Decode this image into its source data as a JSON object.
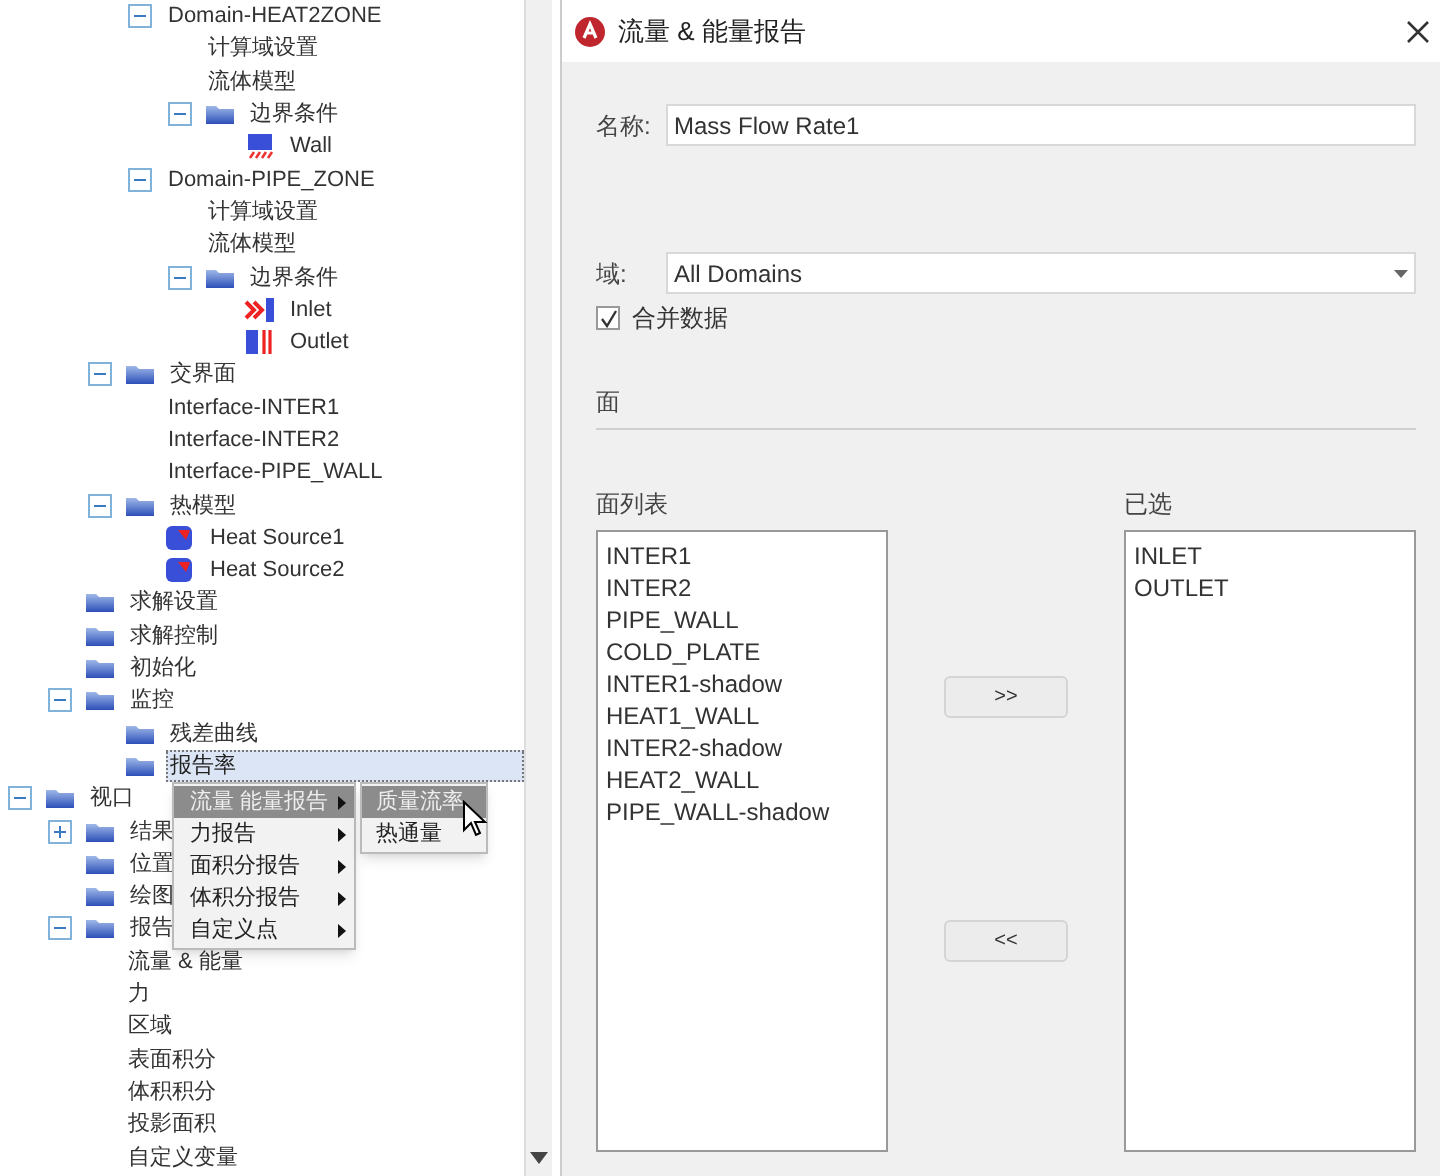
{
  "tree": {
    "items": [
      {
        "children": [
          {
            "children": [
              {
                "children": [
                  {
                    "label": "Domain-HEAT2ZONE",
                    "kind": "none",
                    "expanded": true,
                    "selected": false,
                    "children": [
                      {
                        "label": "计算域设置",
                        "kind": "none",
                        "selected": false
                      },
                      {
                        "label": "流体模型",
                        "kind": "none",
                        "selected": false
                      },
                      {
                        "label": "边界条件",
                        "kind": "folder",
                        "expanded": true,
                        "selected": false,
                        "children": [
                          {
                            "label": "Wall",
                            "kind": "wall",
                            "selected": false
                          }
                        ]
                      }
                    ]
                  },
                  {
                    "label": "Domain-PIPE_ZONE",
                    "kind": "none",
                    "expanded": true,
                    "selected": false,
                    "children": [
                      {
                        "label": "计算域设置",
                        "kind": "none",
                        "selected": false
                      },
                      {
                        "label": "流体模型",
                        "kind": "none",
                        "selected": false
                      },
                      {
                        "label": "边界条件",
                        "kind": "folder",
                        "expanded": true,
                        "selected": false,
                        "children": [
                          {
                            "label": "Inlet",
                            "kind": "inlet",
                            "selected": false
                          },
                          {
                            "label": "Outlet",
                            "kind": "outlet",
                            "selected": false
                          }
                        ]
                      }
                    ]
                  }
                ]
              },
              {
                "label": "交界面",
                "kind": "folder",
                "expanded": true,
                "selected": false,
                "children": [
                  {
                    "label": "Interface-INTER1",
                    "kind": "none",
                    "selected": false
                  },
                  {
                    "label": "Interface-INTER2",
                    "kind": "none",
                    "selected": false
                  },
                  {
                    "label": "Interface-PIPE_WALL",
                    "kind": "none",
                    "selected": false
                  }
                ]
              },
              {
                "label": "热模型",
                "kind": "folder",
                "expanded": true,
                "selected": false,
                "children": [
                  {
                    "label": "Heat Source1",
                    "kind": "heat_source",
                    "selected": false
                  },
                  {
                    "label": "Heat Source2",
                    "kind": "heat_source",
                    "selected": false
                  }
                ]
              }
            ]
          },
          {
            "label": "求解设置",
            "kind": "folder",
            "selected": false
          },
          {
            "label": "求解控制",
            "kind": "folder",
            "selected": false
          },
          {
            "label": "初始化",
            "kind": "folder",
            "selected": false
          },
          {
            "label": "监控",
            "kind": "folder",
            "expanded": true,
            "selected": false,
            "children": [
              {
                "label": "残差曲线",
                "kind": "folder",
                "selected": false
              },
              {
                "label": "报告率",
                "kind": "folder",
                "selected": true
              }
            ]
          }
        ]
      },
      {
        "label": "视口",
        "kind": "folder",
        "expanded": true,
        "selected": false,
        "children": [
          {
            "label": "结果",
            "kind": "folder",
            "expanded": false,
            "selected": false
          },
          {
            "label": "位置",
            "kind": "folder",
            "selected": false
          },
          {
            "label": "绘图",
            "kind": "folder",
            "selected": false
          },
          {
            "label": "报告",
            "kind": "folder",
            "expanded": true,
            "selected": false,
            "children": [
              {
                "label": "流量 & 能量",
                "kind": "none",
                "selected": false
              },
              {
                "label": "力",
                "kind": "none",
                "selected": false
              },
              {
                "label": "区域",
                "kind": "none",
                "selected": false
              },
              {
                "label": "表面积分",
                "kind": "none",
                "selected": false
              },
              {
                "label": "体积积分",
                "kind": "none",
                "selected": false
              },
              {
                "label": "投影面积",
                "kind": "none",
                "selected": false
              },
              {
                "label": "自定义变量",
                "kind": "none",
                "selected": false
              }
            ]
          }
        ]
      }
    ]
  },
  "context_menu": {
    "items": [
      {
        "label": "流量 能量报告",
        "selected": true
      },
      {
        "label": "力报告",
        "selected": false
      },
      {
        "label": "面积分报告",
        "selected": false
      },
      {
        "label": "体积分报告",
        "selected": false
      },
      {
        "label": "自定义点",
        "selected": false
      }
    ],
    "submenu": [
      {
        "label": "质量流率",
        "selected": true
      },
      {
        "label": "热通量",
        "selected": false
      }
    ]
  },
  "dialog": {
    "title": "流量 & 能量报告",
    "name_label": "名称:",
    "name_value": "Mass Flow Rate1",
    "domain_label": "域:",
    "domain_value": "All Domains",
    "merge_label": "合并数据",
    "merge_checked": true,
    "faces_section": "面",
    "face_list_label": "面列表",
    "face_list": [
      "INTER1",
      "INTER2",
      "PIPE_WALL",
      "COLD_PLATE",
      "INTER1-shadow",
      "HEAT1_WALL",
      "INTER2-shadow",
      "HEAT2_WALL",
      "PIPE_WALL-shadow"
    ],
    "add_button": ">>",
    "remove_button": "<<",
    "selected_label": "已选",
    "selected_list": [
      "INLET",
      "OUTLET"
    ]
  }
}
